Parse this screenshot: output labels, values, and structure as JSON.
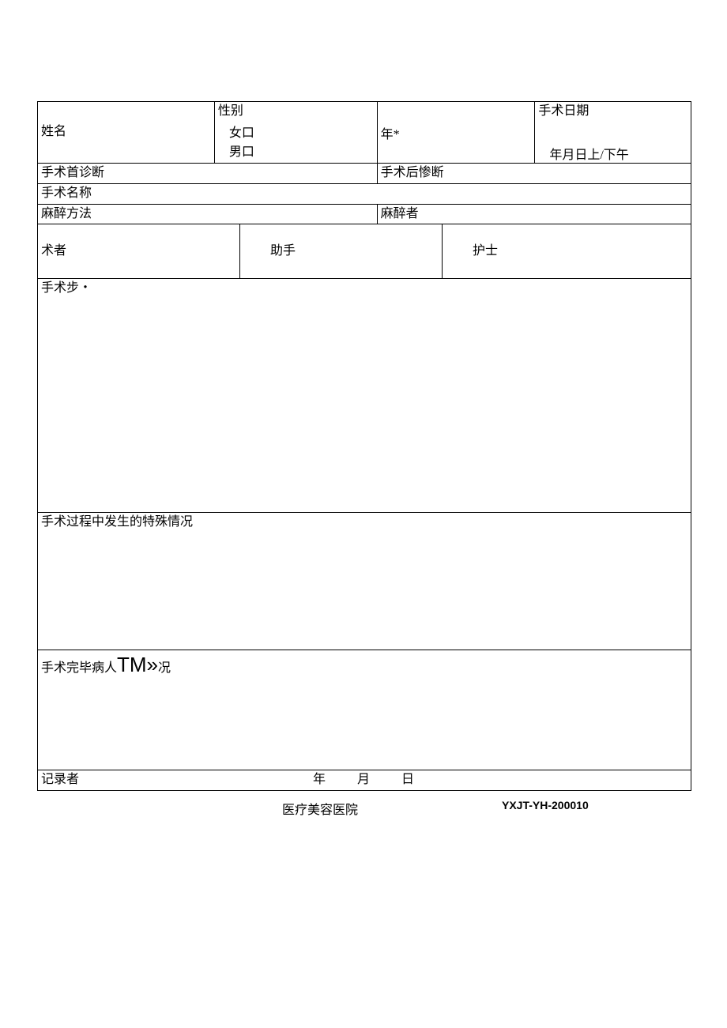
{
  "labels": {
    "name": "姓名",
    "gender": "性别",
    "gender_female": "女口",
    "gender_male": "男口",
    "age": "年*",
    "surgery_date": "手术日期",
    "surgery_date_fill": "年月日上/下午",
    "pre_diagnosis": "手术首诊断",
    "post_diagnosis": "手术后惨断",
    "surgery_name": "手术名称",
    "anesthesia_method": "麻醉方法",
    "anesthetist": "麻醉者",
    "surgeon": "术者",
    "assistant": "助手",
    "nurse": "护士",
    "steps": "手术步・",
    "special": "手术过程中发生的特殊情况",
    "condition_prefix": "手术完毕病人",
    "condition_tm": "TM»",
    "condition_suffix": "况",
    "recorder": "记录者",
    "date_year": "年",
    "date_month": "月",
    "date_day": "日"
  },
  "footer": {
    "hospital": "医疗美容医院",
    "code": "YXJT-YH-200010"
  }
}
